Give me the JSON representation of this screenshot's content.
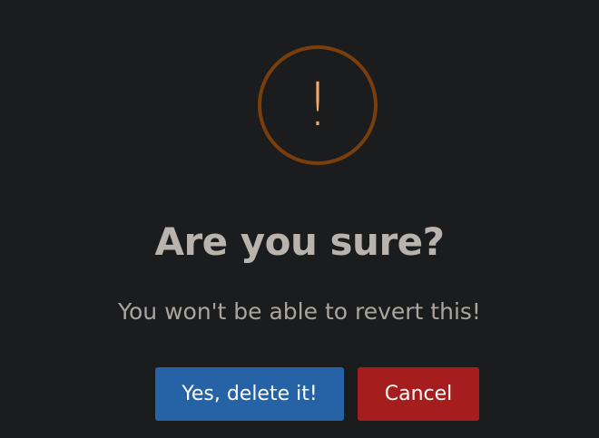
{
  "dialog": {
    "icon": "exclamation-warning-icon",
    "icon_glyph": "!",
    "icon_ring_color": "#7a3e0c",
    "icon_glyph_color": "#f0a86b",
    "title": "Are you sure?",
    "message": "You won't be able to revert this!",
    "confirm_label": "Yes, delete it!",
    "cancel_label": "Cancel",
    "confirm_color": "#2563a6",
    "cancel_color": "#a61d1d"
  }
}
